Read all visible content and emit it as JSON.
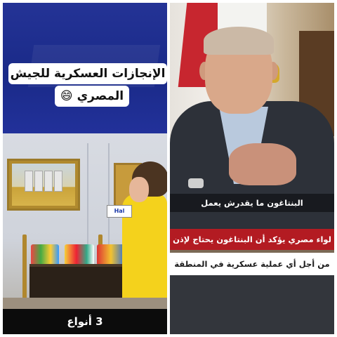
{
  "left_panel": {
    "caption_line1": "الإنجازات العسكرية للجيش",
    "caption_line2": "المصري 😄",
    "bottom_caption": "3 أنواع",
    "mic_label": "Hal"
  },
  "right_panel": {
    "ticker_top": "البنتاغون ما يقدرش يعمل",
    "ticker_red": "لواء مصري يؤكد أن البنتاغون يحتاج لإذن",
    "ticker_white": "من أجل أي عملية عسكرية في المنطقة"
  },
  "colors": {
    "left_background": "#1d2a8a",
    "coat": "#f4d21c",
    "ticker_red": "#b31b22",
    "flag_red": "#c7262f"
  }
}
